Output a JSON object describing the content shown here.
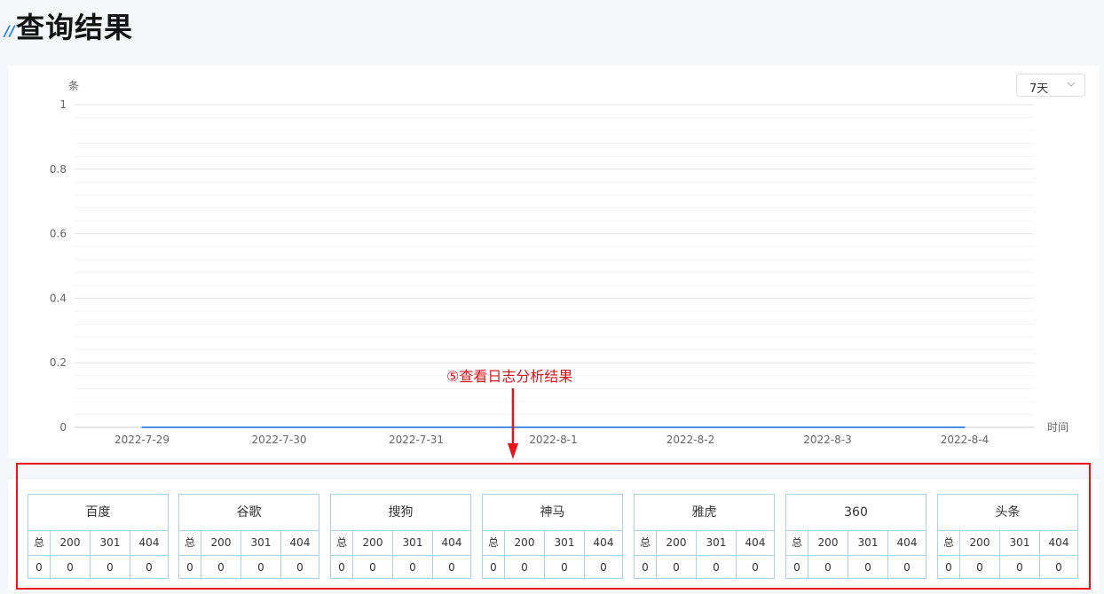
{
  "page_title": "查询结果",
  "range_select": {
    "value": "7天"
  },
  "annotation": "⑤查看日志分析结果",
  "colors": {
    "line": "#4a90e2",
    "annotation": "#e8141a",
    "table_border": "#a9d4e8"
  },
  "chart_data": {
    "type": "line",
    "ylabel": "条",
    "xlabel": "时间",
    "ylim": [
      0,
      1
    ],
    "yticks": [
      "0",
      "0.2",
      "0.4",
      "0.6",
      "0.8",
      "1"
    ],
    "categories": [
      "2022-7-29",
      "2022-7-30",
      "2022-7-31",
      "2022-8-1",
      "2022-8-2",
      "2022-8-3",
      "2022-8-4"
    ],
    "series": [
      {
        "values": [
          0,
          0,
          0,
          0,
          0,
          0,
          0
        ]
      }
    ],
    "grid": true
  },
  "engines": [
    {
      "name": "百度",
      "headers": [
        "总",
        "200",
        "301",
        "404"
      ],
      "values": [
        "0",
        "0",
        "0",
        "0"
      ]
    },
    {
      "name": "谷歌",
      "headers": [
        "总",
        "200",
        "301",
        "404"
      ],
      "values": [
        "0",
        "0",
        "0",
        "0"
      ]
    },
    {
      "name": "搜狗",
      "headers": [
        "总",
        "200",
        "301",
        "404"
      ],
      "values": [
        "0",
        "0",
        "0",
        "0"
      ]
    },
    {
      "name": "神马",
      "headers": [
        "总",
        "200",
        "301",
        "404"
      ],
      "values": [
        "0",
        "0",
        "0",
        "0"
      ]
    },
    {
      "name": "雅虎",
      "headers": [
        "总",
        "200",
        "301",
        "404"
      ],
      "values": [
        "0",
        "0",
        "0",
        "0"
      ]
    },
    {
      "name": "360",
      "headers": [
        "总",
        "200",
        "301",
        "404"
      ],
      "values": [
        "0",
        "0",
        "0",
        "0"
      ]
    },
    {
      "name": "头条",
      "headers": [
        "总",
        "200",
        "301",
        "404"
      ],
      "values": [
        "0",
        "0",
        "0",
        "0"
      ]
    }
  ]
}
